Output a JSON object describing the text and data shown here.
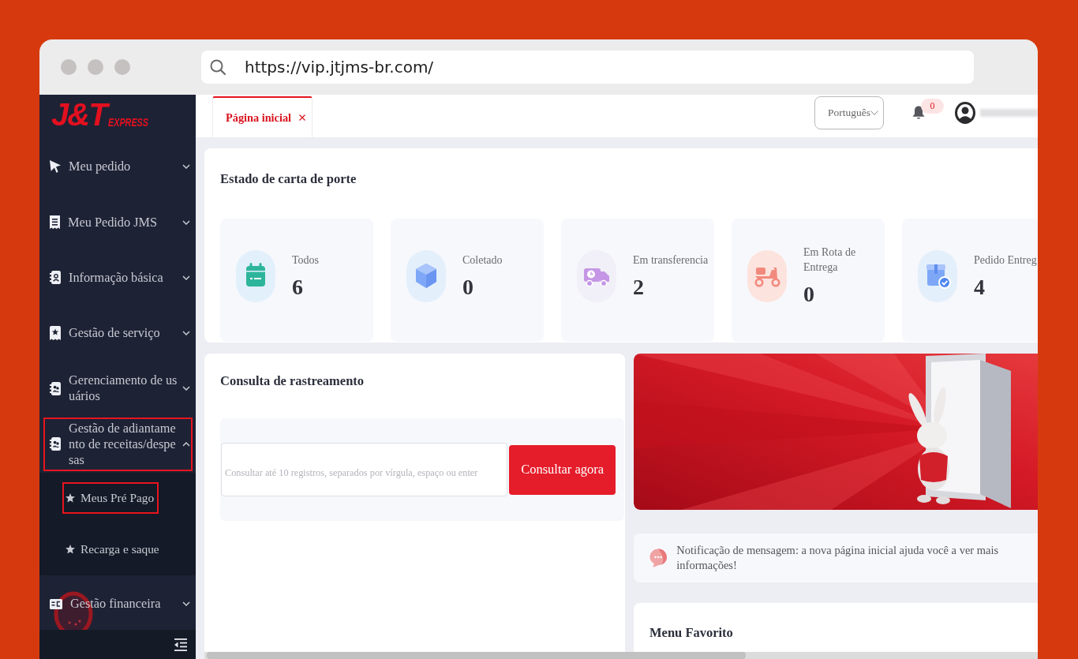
{
  "browser": {
    "url": "https://vip.jtjms-br.com/"
  },
  "sidebar": {
    "logo": {
      "mark": "J&T",
      "word": "EXPRESS"
    },
    "items": [
      {
        "label": "Meu pedido",
        "expanded": false,
        "highlighted": false
      },
      {
        "label": "Meu Pedido JMS",
        "expanded": false,
        "highlighted": false
      },
      {
        "label": "Informação básica",
        "expanded": false,
        "highlighted": false
      },
      {
        "label": "Gestão de serviço",
        "expanded": false,
        "highlighted": false
      },
      {
        "label": "Gerenciamento de usuários",
        "expanded": false,
        "highlighted": false
      },
      {
        "label": "Gestão de adiantamento de receitas/despesas",
        "expanded": true,
        "highlighted": true,
        "children": [
          {
            "label": "Meus Pré Pago",
            "highlighted": true
          },
          {
            "label": "Recarga e saque",
            "highlighted": false
          }
        ]
      },
      {
        "label": "Gestão financeira",
        "expanded": false,
        "highlighted": false
      }
    ]
  },
  "header": {
    "tabs": [
      {
        "label": "Página inicial",
        "selected": true
      }
    ],
    "language": {
      "value": "Português"
    },
    "notifications": {
      "count": "0"
    }
  },
  "waybill_status": {
    "title": "Estado de carta de porte",
    "stats": [
      {
        "label": "Todos",
        "value": "6"
      },
      {
        "label": "Coletado",
        "value": "0"
      },
      {
        "label": "Em transferencia",
        "value": "2"
      },
      {
        "label": "Em Rota de Entrega",
        "value": "0"
      },
      {
        "label": "Pedido Entreg",
        "value": "4"
      }
    ]
  },
  "tracking": {
    "title": "Consulta de rastreamento",
    "input": {
      "placeholder": "Consultar até 10 registros, separados por vírgula, espaço ou enter"
    },
    "button": "Consultar agora"
  },
  "notice": {
    "text": "Notificação de mensagem: a nova página inicial ajuda você a ver mais informações!"
  },
  "favorites": {
    "title": "Menu Favorito"
  }
}
